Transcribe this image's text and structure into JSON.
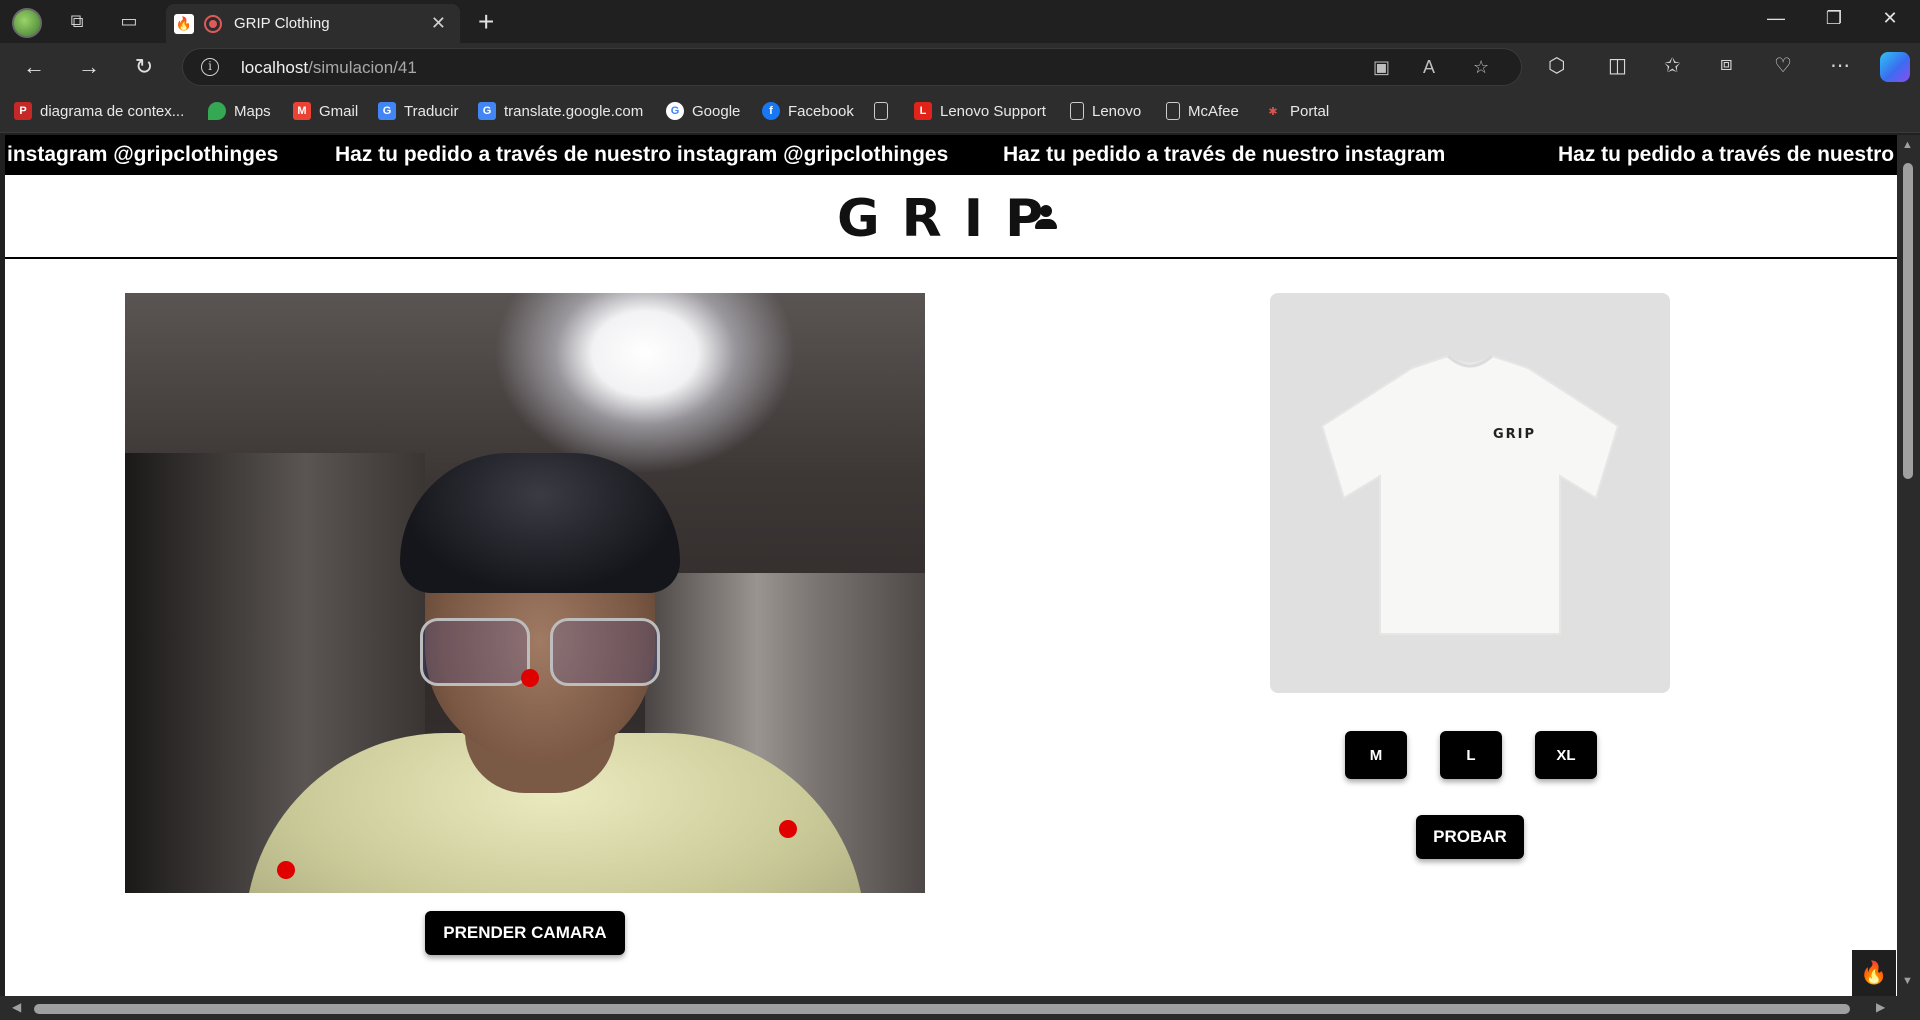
{
  "browser": {
    "tab_title": "GRIP Clothing",
    "url_host": "localhost",
    "url_path": "/simulacion/41",
    "bookmarks": [
      {
        "label": "diagrama de contex...",
        "icon": "pdf-icon",
        "color": "#c62828"
      },
      {
        "label": "Maps",
        "icon": "maps-pin-icon",
        "color": "#34a853"
      },
      {
        "label": "Gmail",
        "icon": "gmail-icon",
        "color": "#ea4335"
      },
      {
        "label": "Traducir",
        "icon": "translate-icon",
        "color": "#4285f4"
      },
      {
        "label": "translate.google.com",
        "icon": "translate-icon",
        "color": "#4285f4"
      },
      {
        "label": "Google",
        "icon": "google-icon",
        "color": "#ffffff"
      },
      {
        "label": "Facebook",
        "icon": "facebook-icon",
        "color": "#1877f2"
      },
      {
        "label": "",
        "icon": "page-icon",
        "color": "#cccccc"
      },
      {
        "label": "Lenovo Support",
        "icon": "lenovo-icon",
        "color": "#e2231a"
      },
      {
        "label": "Lenovo",
        "icon": "page-icon",
        "color": "#cccccc"
      },
      {
        "label": "McAfee",
        "icon": "page-icon",
        "color": "#cccccc"
      },
      {
        "label": "Portal",
        "icon": "portal-icon",
        "color": "#d9534f"
      }
    ]
  },
  "page": {
    "marquee": [
      "instagram @gripclothinges",
      "Haz tu pedido a través de nuestro instagram @gripclothinges",
      "Haz tu pedido a través de nuestro instagram",
      "Haz tu pedido a través de nuestro"
    ],
    "logo": "GRIP",
    "camera_button": "PRENDER CAMARA",
    "product_print": "GRIP",
    "sizes": [
      "M",
      "L",
      "XL"
    ],
    "try_button": "PROBAR"
  },
  "colors": {
    "marquee_bg": "#000000",
    "button_bg": "#000000",
    "pose_dot": "#e00000",
    "product_bg": "#e0e0e0"
  }
}
